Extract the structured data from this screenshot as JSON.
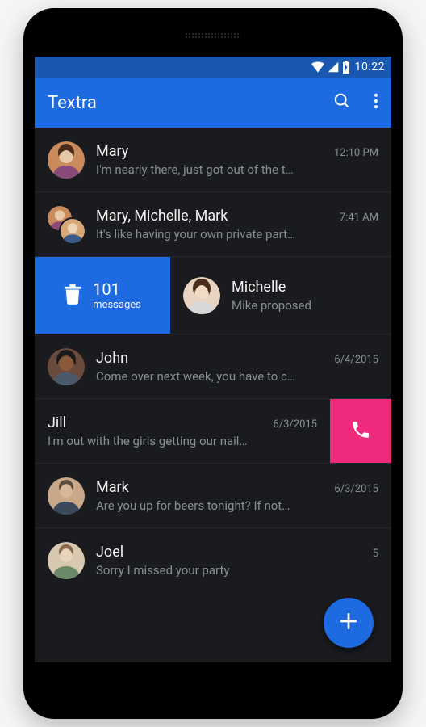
{
  "status": {
    "time": "10:22"
  },
  "appbar": {
    "title": "Textra"
  },
  "conversations": [
    {
      "name": "Mary",
      "time": "12:10 PM",
      "preview": "I'm nearly there, just got out of the t…"
    },
    {
      "name": "Mary, Michelle, Mark",
      "time": "7:41 AM",
      "preview": "It's like having your own private part…"
    },
    {
      "name": "Michelle",
      "time": "",
      "preview": "Mike proposed"
    },
    {
      "name": "John",
      "time": "6/4/2015",
      "preview": "Come over next week, you have to c…"
    },
    {
      "name": "Jill",
      "time": "6/3/2015",
      "preview": "I'm out with the girls getting our nail…"
    },
    {
      "name": "Mark",
      "time": "6/3/2015",
      "preview": "Are you up for beers tonight? If not…"
    },
    {
      "name": "Joel",
      "time": "5",
      "preview": "Sorry I missed your party"
    }
  ],
  "swipe": {
    "delete_count": "101",
    "delete_label": "messages"
  }
}
